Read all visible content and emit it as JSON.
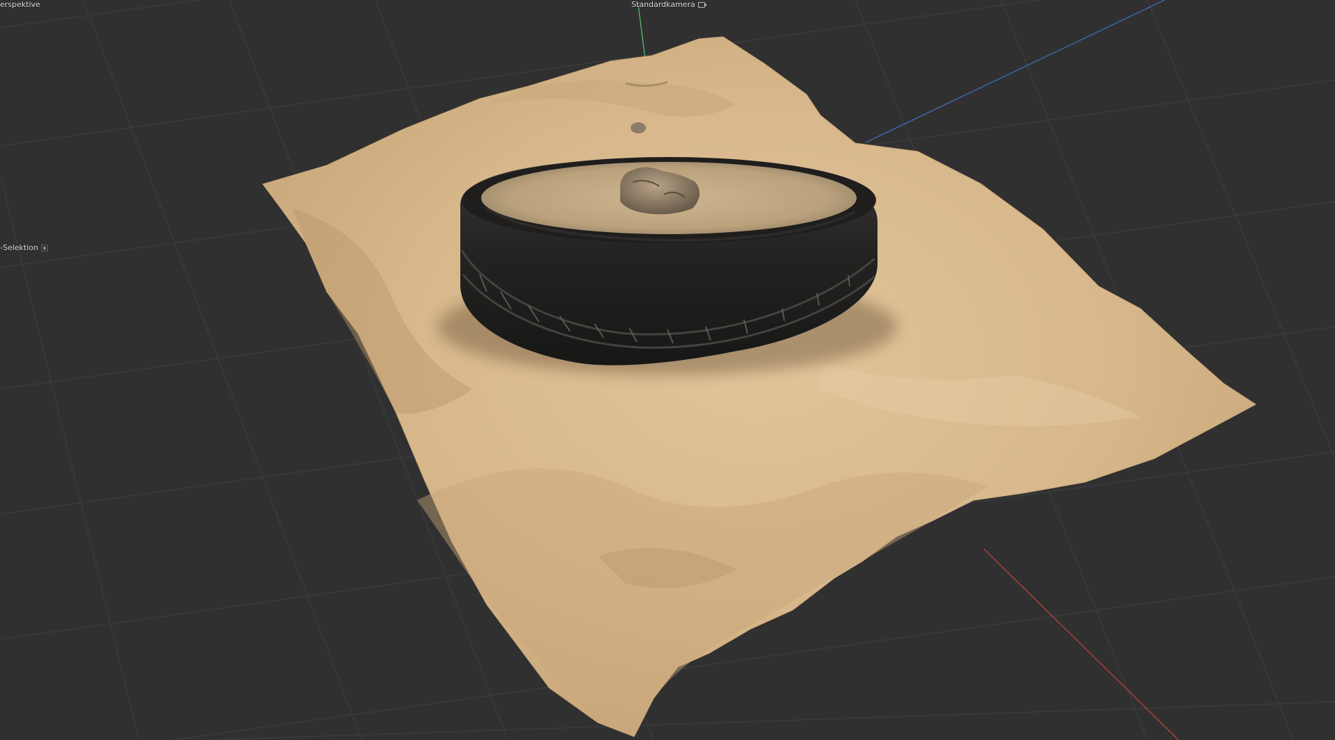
{
  "viewport": {
    "view_name": "erspektive",
    "camera_name": "Standardkamera",
    "selection_label": "-Selektion"
  },
  "icons": {
    "camera": "camera-icon",
    "selection_arrow": "play-arrow-icon"
  },
  "colors": {
    "background": "#303030",
    "grid": "#3b3b3b",
    "axis_x": "#b4433a",
    "axis_y": "#4fb06a",
    "axis_z": "#3f69b0",
    "sand": "#d9b98e",
    "tire": "#262626"
  }
}
